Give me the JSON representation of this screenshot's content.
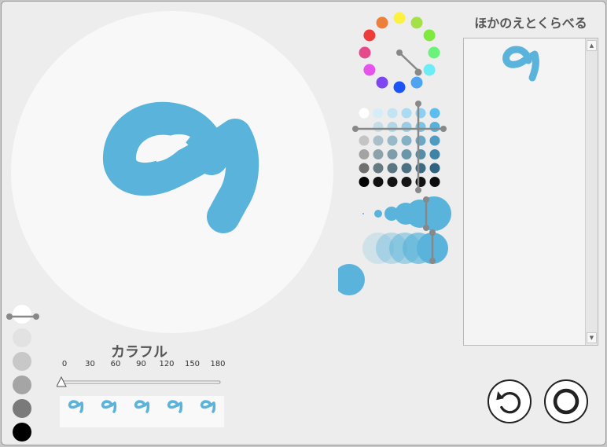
{
  "compare_panel": {
    "title": "ほかのえとくらべる",
    "scroll_up": "▲",
    "scroll_down": "▼"
  },
  "hue_control": {
    "label": "カラフル",
    "ticks": [
      "0",
      "30",
      "60",
      "90",
      "120",
      "150",
      "180"
    ],
    "value": 0,
    "max": 180
  },
  "brush": {
    "color": "#5ab3da"
  },
  "color_wheel": {
    "colors": [
      "#fcf141",
      "#a4e048",
      "#7fea3d",
      "#6bf27b",
      "#6cecf7",
      "#4fa4f2",
      "#1c53f7",
      "#7d46f1",
      "#e553ec",
      "#e54a8b",
      "#ee3d39",
      "#ee7f3a"
    ]
  },
  "swatch_grid": {
    "rows": [
      [
        "#ffffff",
        "#d6edf8",
        "#c2e5f5",
        "#a9dbf3",
        "#8bd0f2",
        "#5cbdef"
      ],
      [
        "#ececec",
        "#c5dde8",
        "#b2d6e6",
        "#9acde4",
        "#7dc3e2",
        "#56b1dc"
      ],
      [
        "#c4c4c4",
        "#a9c0ca",
        "#98b9c8",
        "#84b1c6",
        "#6aa8c5",
        "#4f9cc2"
      ],
      [
        "#a3a3a3",
        "#8ca2ab",
        "#7e9daa",
        "#6b96a9",
        "#558da9",
        "#3f83a5"
      ],
      [
        "#707070",
        "#667a82",
        "#5a7682",
        "#4c7183",
        "#3c6b83",
        "#2e6381"
      ],
      [
        "#000000",
        "#111111",
        "#141414",
        "#161616",
        "#121212",
        "#0c0c0c"
      ]
    ]
  },
  "grays": [
    "#ffffff",
    "#e2e2e2",
    "#c8c8c8",
    "#a5a5a5",
    "#7a7a7a",
    "#000000"
  ],
  "buttons": {
    "undo_label": "",
    "ok_label": ""
  }
}
